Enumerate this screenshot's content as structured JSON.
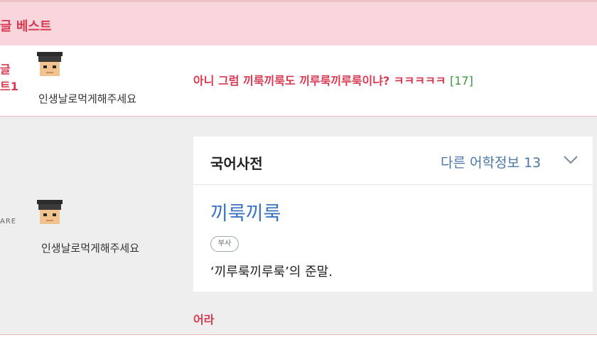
{
  "header": {
    "title": "글 베스트"
  },
  "rows": [
    {
      "label_lines": [
        "글",
        "트1"
      ],
      "nickname": "인생날로먹게해주세요",
      "post_text": "아니 그럼 끼룩끼룩도 끼루룩끼루룩이냐? ㅋㅋㅋㅋㅋ",
      "comment_count": "[17]"
    },
    {
      "side_label": "ARE",
      "nickname": "인생날로먹게해주세요",
      "dictionary": {
        "title": "국어사전",
        "more": "다른 어학정보 13",
        "word": "끼룩끼룩",
        "pos": "부사",
        "definition": "‘끼루룩끼루룩’의 준말."
      },
      "reply_text": "어라"
    }
  ],
  "colors": {
    "accent": "#d93a51",
    "header_bg": "#f8d6dc",
    "link_blue": "#3b73c4",
    "count_green": "#3a9a3a"
  }
}
